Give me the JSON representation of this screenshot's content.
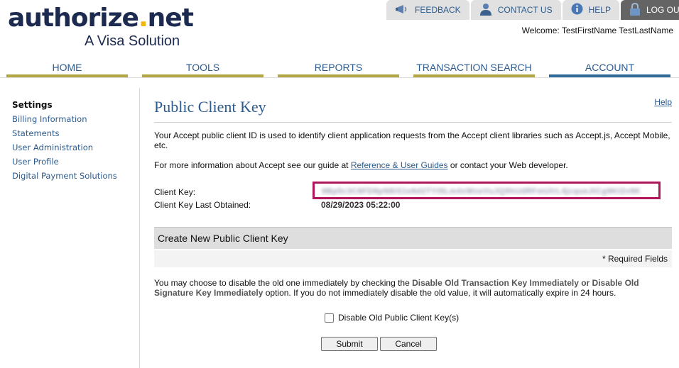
{
  "brand": {
    "logo_text_part1": "authorize",
    "logo_dot": ".",
    "logo_text_part2": "net",
    "tagline": "A Visa Solution",
    "colors": {
      "navy": "#1b2a4e",
      "gold": "#f2b705",
      "link": "#2c5b8f",
      "nav_underline": "#b2a743",
      "nav_active_underline": "#2f6c9b",
      "highlight": "#b3155c"
    }
  },
  "topbar": {
    "feedback": {
      "label": "FEEDBACK",
      "icon": "megaphone-icon"
    },
    "contact": {
      "label": "CONTACT US",
      "icon": "person-icon"
    },
    "help": {
      "label": "HELP",
      "icon": "info-icon"
    },
    "logout": {
      "label": "LOG OUT",
      "icon": "lock-icon"
    }
  },
  "welcome": "Welcome: TestFirstName TestLastName",
  "nav": {
    "items": [
      {
        "label": "HOME"
      },
      {
        "label": "TOOLS"
      },
      {
        "label": "REPORTS"
      },
      {
        "label": "TRANSACTION SEARCH"
      },
      {
        "label": "ACCOUNT"
      }
    ],
    "active": "ACCOUNT"
  },
  "sidebar": {
    "heading": "Settings",
    "items": [
      {
        "label": "Billing Information"
      },
      {
        "label": "Statements"
      },
      {
        "label": "User Administration"
      },
      {
        "label": "User Profile"
      },
      {
        "label": "Digital Payment Solutions"
      }
    ]
  },
  "main": {
    "title": "Public Client Key",
    "help": "Help",
    "intro": "Your Accept public client ID is used to identify client application requests from the Accept client libraries such as Accept.js, Accept Mobile, etc.",
    "more_info_prefix": "For more information about Accept see our guide at ",
    "more_info_link": "Reference & User Guides",
    "more_info_suffix": " or contact your Web developer.",
    "client_key_label": "Client Key:",
    "client_key_value": "9Bp5c3C8FD8pN8iS1e8d2TYt5Lm4xWxeVuJQ9hUdRFmUlrL4jcqueJtCg9Kt2v9K",
    "last_obtained_label": "Client Key Last Obtained:",
    "last_obtained_value": "08/29/2023 05:22:00"
  },
  "create": {
    "heading": "Create New Public Client Key",
    "required_note": "* Required Fields",
    "text_prefix": "You may choose to disable the old one immediately by checking the ",
    "text_bold": "Disable Old Transaction Key Immediately or Disable Old Signature Key Immediately",
    "text_suffix": " option. If you do not immediately disable the old value, it will automatically expire in 24 hours.",
    "checkbox_label": "Disable Old Public Client Key(s)",
    "checkbox_checked": false,
    "submit": "Submit",
    "cancel": "Cancel"
  }
}
